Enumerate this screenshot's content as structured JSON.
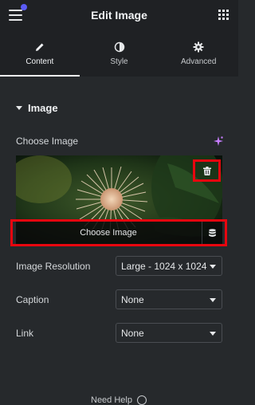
{
  "header": {
    "title": "Edit Image"
  },
  "tabs": [
    {
      "label": "Content",
      "icon": "pencil-icon"
    },
    {
      "label": "Style",
      "icon": "contrast-icon"
    },
    {
      "label": "Advanced",
      "icon": "gear-icon"
    }
  ],
  "section": {
    "title": "Image"
  },
  "choose_image": {
    "label": "Choose Image",
    "button_label": "Choose Image"
  },
  "fields": {
    "resolution": {
      "label": "Image Resolution",
      "value": "Large - 1024 x 1024"
    },
    "caption": {
      "label": "Caption",
      "value": "None"
    },
    "link": {
      "label": "Link",
      "value": "None"
    }
  },
  "footer": {
    "help_label": "Need Help"
  },
  "colors": {
    "highlight": "#e8060f",
    "accent": "#5b5bf5",
    "sparkle": "#c77dff"
  }
}
